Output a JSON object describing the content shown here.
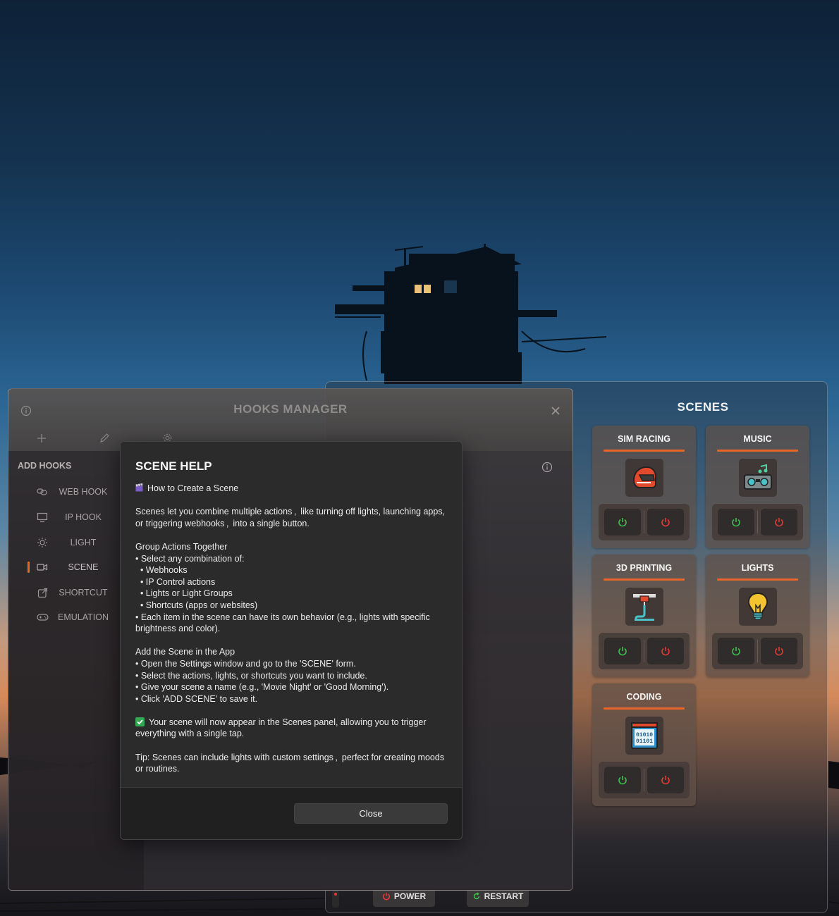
{
  "scenes": {
    "title": "SCENES",
    "cards": [
      {
        "name": "SIM RACING",
        "icon": "racing-helmet-icon"
      },
      {
        "name": "MUSIC",
        "icon": "boombox-icon"
      },
      {
        "name": "3D PRINTING",
        "icon": "3d-printer-icon"
      },
      {
        "name": "LIGHTS",
        "icon": "light-bulb-icon"
      },
      {
        "name": "CODING",
        "icon": "binary-code-icon"
      }
    ],
    "bottom_bar": {
      "power_label": "POWER",
      "restart_label": "RESTART"
    },
    "colors": {
      "accent": "#e8662a",
      "on": "#3cc04a",
      "off": "#e53935"
    }
  },
  "hooks_manager": {
    "title": "HOOKS MANAGER",
    "section_label": "ADD HOOKS",
    "nav": [
      {
        "label": "WEB HOOK",
        "icon": "link-icon"
      },
      {
        "label": "IP HOOK",
        "icon": "monitor-icon"
      },
      {
        "label": "LIGHT",
        "icon": "sun-icon"
      },
      {
        "label": "SCENE",
        "icon": "video-camera-icon",
        "active": true
      },
      {
        "label": "SHORTCUT",
        "icon": "external-link-icon"
      },
      {
        "label": "EMULATION",
        "icon": "gamepad-icon"
      }
    ],
    "toolbar_icons": [
      "plus-icon",
      "pencil-icon",
      "gear-icon"
    ]
  },
  "dialog": {
    "title": "SCENE HELP",
    "subtitle": "How to Create a Scene",
    "intro_1": "Scenes let you combine multiple actions ,  like turning off lights, launching apps,",
    "intro_2": "or triggering webhooks ,  into a single button.",
    "group_heading": "Group Actions Together",
    "group_lines": [
      "• Select any combination of:",
      "  • Webhooks",
      "  • IP Control actions",
      "  • Lights or Light Groups",
      "  • Shortcuts (apps or websites)",
      "• Each item in the scene can have its own behavior (e.g., lights with specific",
      "brightness and color)."
    ],
    "add_heading": "Add the Scene in the App",
    "add_lines": [
      "• Open the Settings window and go to the 'SCENE' form.",
      "• Select the actions, lights, or shortcuts you want to include.",
      "• Give your scene a name (e.g., 'Movie Night' or 'Good Morning').",
      "• Click 'ADD SCENE' to save it."
    ],
    "result_1": "Your scene will now appear in the Scenes panel, allowing you to trigger",
    "result_2": "everything with a single tap.",
    "tip_1": "Tip: Scenes can include lights with custom settings ,  perfect for creating moods",
    "tip_2": "or routines.",
    "close_label": "Close"
  }
}
